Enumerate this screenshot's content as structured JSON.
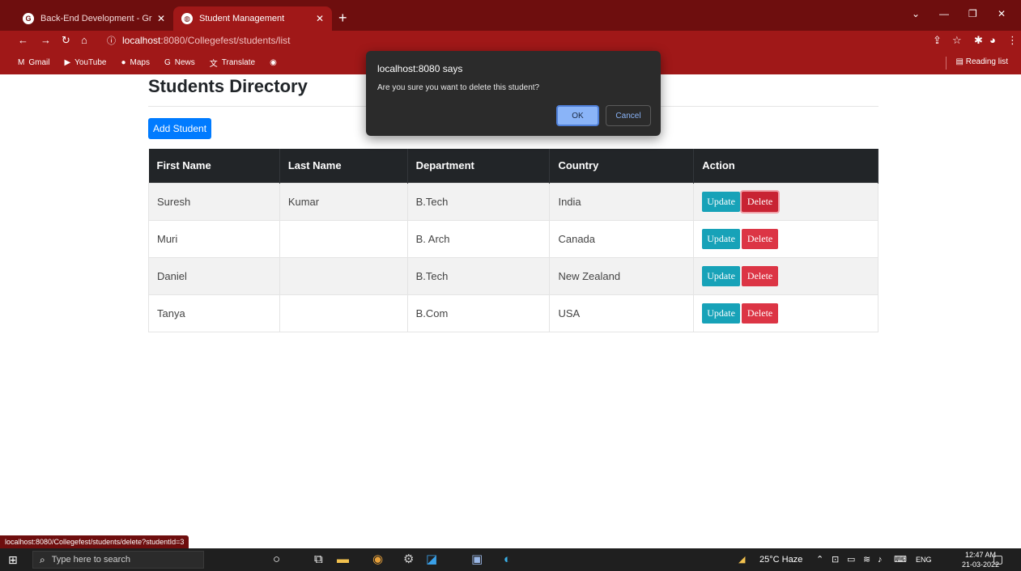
{
  "browser": {
    "tabs": [
      {
        "title": "Back-End Development - Great L",
        "favicon": "G"
      },
      {
        "title": "Student Management",
        "favicon": "globe-icon"
      }
    ],
    "new_tab_symbol": "+",
    "url_host": "localhost",
    "url_path": ":8080/Collegefest/students/list",
    "bookmarks": [
      {
        "label": "Gmail",
        "icon": "M"
      },
      {
        "label": "YouTube",
        "icon": "▶"
      },
      {
        "label": "Maps",
        "icon": "●"
      },
      {
        "label": "News",
        "icon": "G"
      },
      {
        "label": "Translate",
        "icon": "文"
      },
      {
        "label": "",
        "icon": "◉"
      }
    ],
    "reading_list": "Reading list"
  },
  "page": {
    "title": "Students Directory",
    "add_button": "Add Student",
    "table": {
      "headers": [
        "First Name",
        "Last Name",
        "Department",
        "Country",
        "Action"
      ],
      "rows": [
        [
          "Suresh",
          "Kumar",
          "B.Tech",
          "India"
        ],
        [
          "Muri",
          "",
          "B. Arch",
          "Canada"
        ],
        [
          "Daniel",
          "",
          "B.Tech",
          "New Zealand"
        ],
        [
          "Tanya",
          "",
          "B.Com",
          "USA"
        ]
      ],
      "update_label": "Update",
      "delete_label": "Delete"
    }
  },
  "dialog": {
    "title": "localhost:8080 says",
    "message": "Are you sure you want to delete this student?",
    "ok_label": "OK",
    "cancel_label": "Cancel"
  },
  "status_url": "localhost:8080/Collegefest/students/delete?studentId=3",
  "taskbar": {
    "search_placeholder": "Type here to search",
    "weather": "25°C Haze",
    "language": "ENG",
    "time": "12:47 AM",
    "date": "21-03-2022"
  },
  "colors": {
    "chrome_dark": "#6e0e0e",
    "chrome": "#a01818",
    "primary": "#007bff",
    "info": "#17a2b8",
    "danger": "#dc3545",
    "table_header": "#222528"
  }
}
